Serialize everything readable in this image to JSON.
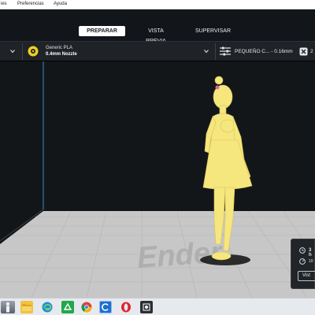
{
  "menu": {
    "items": [
      "ies",
      "Preferencias",
      "Ayuda"
    ]
  },
  "stages": {
    "prepare": "PREPARAR",
    "preview": "VISTA PREVIA",
    "monitor": "SUPERVISAR",
    "active": "PREPARAR"
  },
  "toolbar": {
    "material_name": "Generic PLA",
    "nozzle": "0.4mm Nozzle",
    "profile": "PEQUEÑO C... - 0.16mm",
    "support_value": "2",
    "icons": [
      "chevron-down-icon",
      "filament-spool-icon",
      "chevron-down-icon",
      "print-settings-sliders-icon",
      "support-icon"
    ]
  },
  "viewport": {
    "plate_watermark": "Ender",
    "model_color": "#f5e67e",
    "plate_color": "#c8c8c8",
    "background_color": "#131619"
  },
  "summary_panel": {
    "time_text": "3 h",
    "filament_text": "10",
    "button_label": "Vist",
    "icons": [
      "clock-icon",
      "weight-icon"
    ]
  },
  "taskbar": {
    "icons": [
      "user-photo-icon",
      "file-explorer-icon",
      "edge-browser-icon",
      "green-app-icon",
      "chrome-browser-icon",
      "cura-app-icon",
      "opera-browser-icon",
      "photo-app-icon"
    ]
  }
}
